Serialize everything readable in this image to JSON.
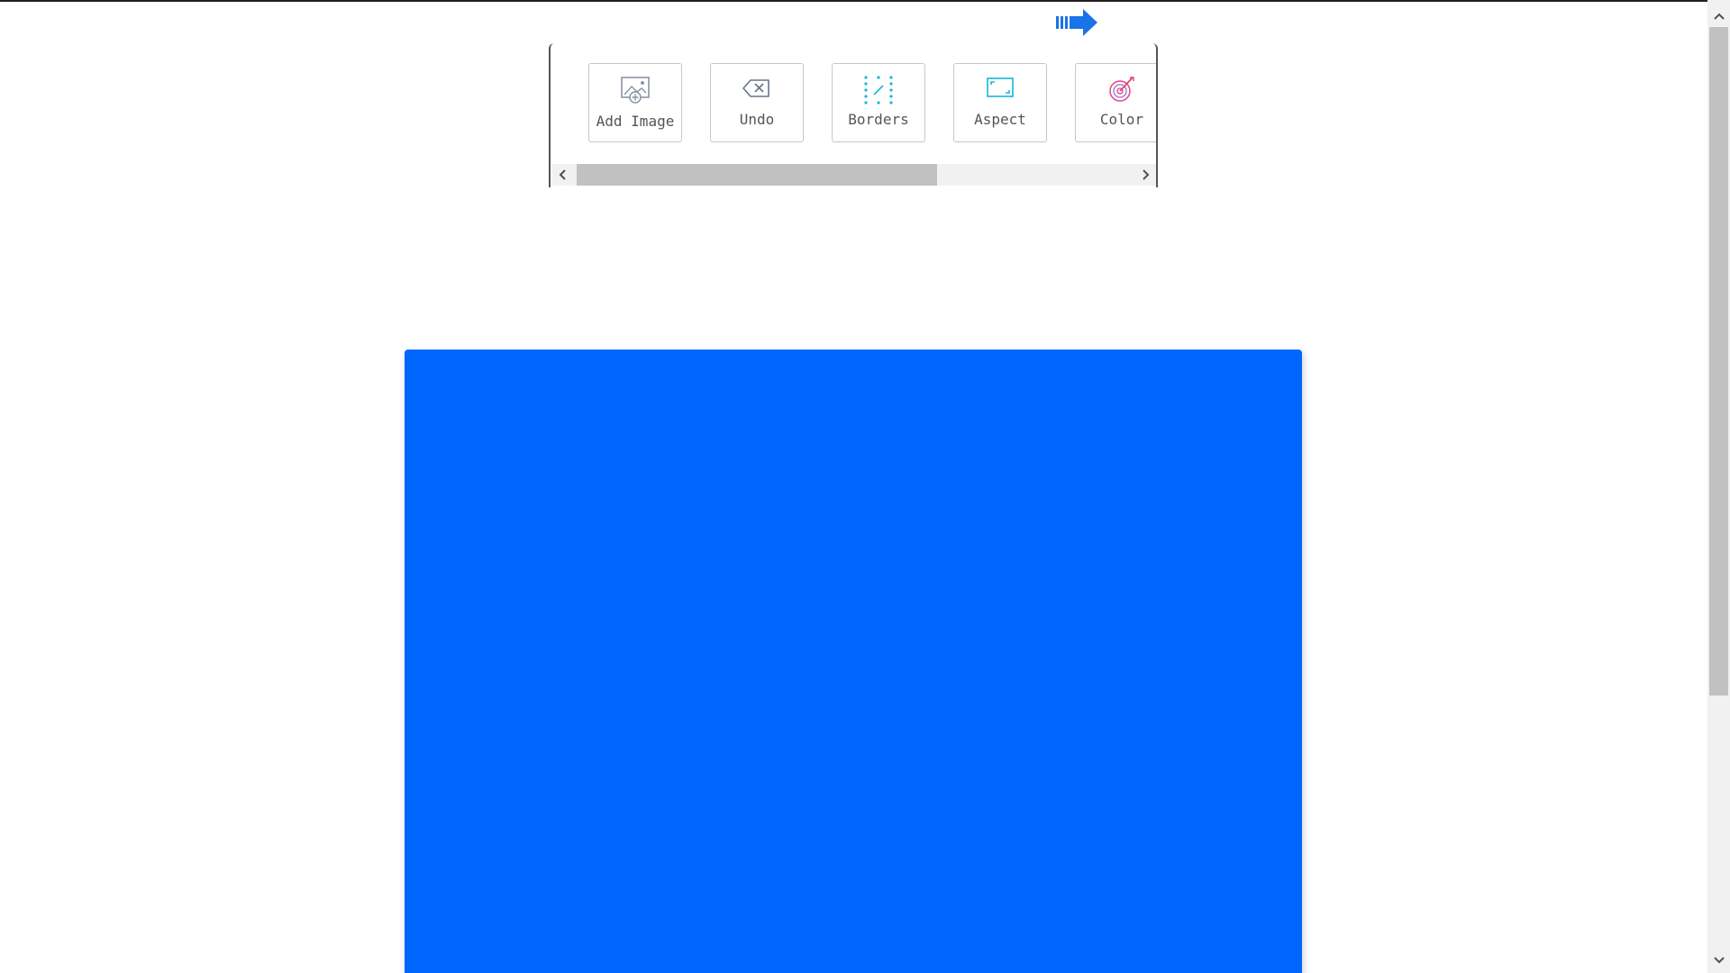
{
  "toolbar": {
    "buttons": [
      {
        "label": "Add Image",
        "icon": "add-image-icon"
      },
      {
        "label": "Undo",
        "icon": "undo-icon"
      },
      {
        "label": "Borders",
        "icon": "borders-icon"
      },
      {
        "label": "Aspect",
        "icon": "aspect-icon"
      },
      {
        "label": "Color",
        "icon": "color-icon"
      }
    ]
  },
  "next_arrow": {
    "icon": "next-arrow-icon"
  },
  "canvas": {
    "color": "#0066ff"
  },
  "colors": {
    "accent_blue": "#1a73e8",
    "icon_gray": "#8a94a6",
    "icon_cyan": "#19b5d8",
    "icon_pink": "#e0457b"
  }
}
